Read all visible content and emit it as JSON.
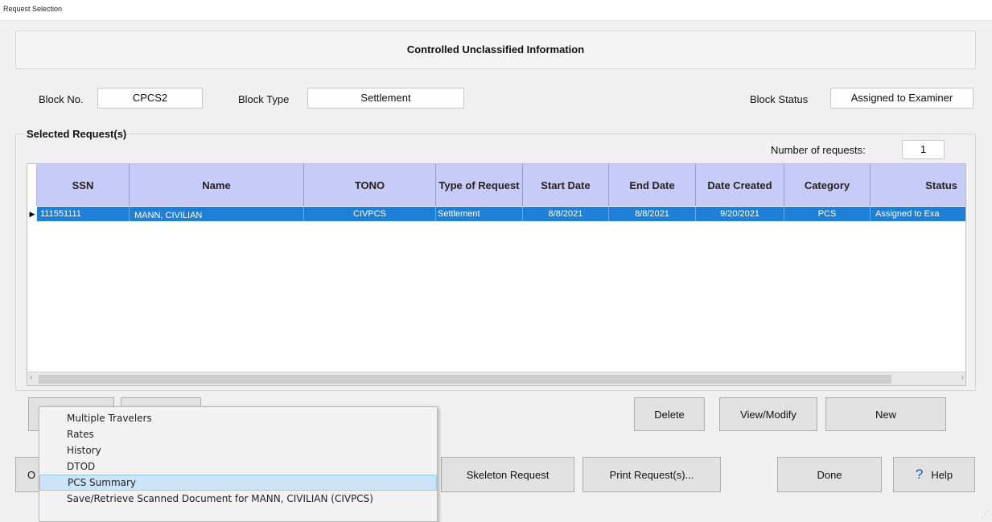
{
  "window": {
    "title": "Request Selection"
  },
  "banner": "Controlled Unclassified Information",
  "block": {
    "no_label": "Block No.",
    "no_value": "CPCS2",
    "type_label": "Block Type",
    "type_value": "Settlement",
    "status_label": "Block Status",
    "status_value": "Assigned to Examiner"
  },
  "selected": {
    "title": "Selected Request(s)",
    "count_label": "Number of requests:",
    "count_value": "1"
  },
  "table": {
    "columns": [
      "SSN",
      "Name",
      "TONO",
      "Type of Request",
      "Start Date",
      "End Date",
      "Date Created",
      "Category",
      "Status"
    ],
    "rows": [
      [
        "111551111",
        "MANN, CIVILIAN",
        "CIVPCS",
        "Settlement",
        "8/8/2021",
        "8/8/2021",
        "9/20/2021",
        "PCS",
        "Assigned to Exa"
      ]
    ],
    "row_indicator": "▶"
  },
  "buttons": {
    "delete": "Delete",
    "view_modify": "View/Modify",
    "new": "New",
    "skeleton": "Skeleton Request",
    "print": "Print Request(s)...",
    "done": "Done",
    "help": "Help",
    "options_partial": "O"
  },
  "context_menu": {
    "items": [
      "Multiple Travelers",
      "Rates",
      "History",
      "DTOD",
      "PCS Summary",
      "Save/Retrieve Scanned Document for MANN, CIVILIAN (CIVPCS)"
    ],
    "highlighted_index": 4
  },
  "colors": {
    "header_bg": "#c8cbf8",
    "selected_row_bg": "#1e7fd6",
    "menu_highlight": "#cce4f7"
  }
}
